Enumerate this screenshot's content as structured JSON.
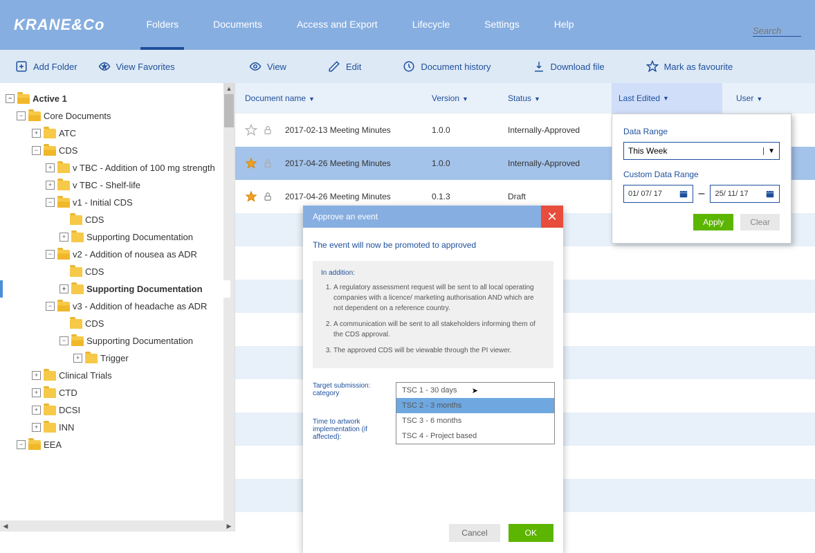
{
  "brand": "KRANE&Co",
  "nav": {
    "folders": "Folders",
    "documents": "Documents",
    "access": "Access and Export",
    "lifecycle": "Lifecycle",
    "settings": "Settings",
    "help": "Help"
  },
  "search_placeholder": "Search",
  "actions_left": {
    "add_folder": "Add Folder",
    "view_favorites": "View Favorites"
  },
  "actions_right": {
    "view": "View",
    "edit": "Edit",
    "history": "Document history",
    "download": "Download file",
    "favourite": "Mark as favourite"
  },
  "tree": {
    "active": "Active 1",
    "core": "Core Documents",
    "atc": "ATC",
    "cds": "CDS",
    "vtbc1": "v TBC - Addition of 100 mg strength",
    "vtbc2": "v TBC - Shelf-life",
    "v1": "v1 - Initial CDS",
    "cds_leaf": "CDS",
    "supdoc": "Supporting Documentation",
    "v2": "v2 - Addition of nousea as ADR",
    "selected": "Supporting Documentation",
    "v3": "v3 - Addition of headache as ADR",
    "trigger": "Trigger",
    "clinical": "Clinical Trials",
    "ctd": "CTD",
    "dcsi": "DCSI",
    "inn": "INN",
    "eea": "EEA"
  },
  "columns": {
    "name": "Document name",
    "version": "Version",
    "status": "Status",
    "last_edited": "Last Edited",
    "user": "User"
  },
  "rows": [
    {
      "name": "2017-02-13 Meeting Minutes",
      "version": "1.0.0",
      "status": "Internally-Approved",
      "starred": false
    },
    {
      "name": "2017-04-26 Meeting Minutes",
      "version": "1.0.0",
      "status": "Internally-Approved",
      "starred": true
    },
    {
      "name": "2017-04-26 Meeting Minutes",
      "version": "0.1.3",
      "status": "Draft",
      "starred": true
    }
  ],
  "filter": {
    "label_range": "Data Range",
    "range_value": "This Week",
    "label_custom": "Custom Data Range",
    "date_from": "01/ 07/ 17",
    "date_to": "25/ 11/ 17",
    "apply": "Apply",
    "clear": "Clear"
  },
  "modal": {
    "title": "Approve an event",
    "lead": "The event will now be promoted to approved",
    "in_addition": "In addition:",
    "li1": "A regulatory assessment request will be sent to all local operating companies with a licence/ marketing authorisation AND which are not dependent on a reference country.",
    "li2": "A communication will be sent to all stakeholders informing them of the CDS approval.",
    "li3": "The approved CDS will be viewable through the PI viewer.",
    "field1": "Target submission: category",
    "field2": "Time to artwork implementation (if affected):",
    "opts": {
      "o1": "TSC 1 - 30 days",
      "o2": "TSC 2 - 3 months",
      "o3": "TSC 3 - 6 months",
      "o4": "TSC 4 - Project based"
    },
    "cancel": "Cancel",
    "ok": "OK"
  }
}
